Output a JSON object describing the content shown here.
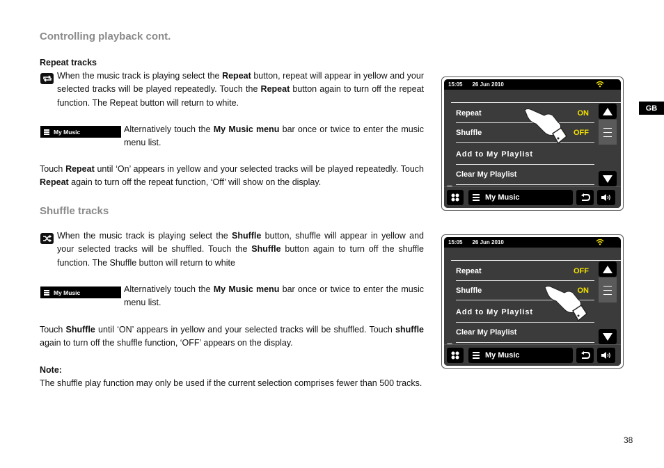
{
  "page": {
    "title": "Controlling playback cont.",
    "language_tab": "GB",
    "page_number": "38"
  },
  "repeat_section": {
    "heading": "Repeat tracks",
    "icon": "repeat-icon",
    "para1": [
      {
        "t": "When the music track is playing select the "
      },
      {
        "b": "Repeat"
      },
      {
        "t": " button, repeat will appear in yellow and your selected tracks will be played repeatedly. Touch the "
      },
      {
        "b": "Repeat"
      },
      {
        "t": " button again to turn off the repeat function. The Repeat button will return to white."
      }
    ],
    "menu_bar_label": "My Music",
    "para2": [
      {
        "t": "Alternatively touch the "
      },
      {
        "b": "My Music menu"
      },
      {
        "t": " bar once or twice to enter the music menu list."
      }
    ],
    "para3": [
      {
        "t": "Touch "
      },
      {
        "b": "Repeat"
      },
      {
        "t": " until ‘On’ appears in yellow and your selected tracks will be played repeatedly. Touch "
      },
      {
        "b": "Repeat"
      },
      {
        "t": " again to turn off the repeat function, ‘Off’ will show on the display."
      }
    ]
  },
  "shuffle_section": {
    "heading": "Shuffle tracks",
    "icon": "shuffle-icon",
    "para1": [
      {
        "t": "When the music track is playing select the "
      },
      {
        "b": "Shuffle"
      },
      {
        "t": " button, shuffle will appear in yellow and your selected tracks will be shuffled. Touch the "
      },
      {
        "b": "Shuffle"
      },
      {
        "t": " button again to turn off the shuffle function. The Shuffle button will return to white"
      }
    ],
    "menu_bar_label": "My Music",
    "para2": [
      {
        "t": "Alternatively touch the "
      },
      {
        "b": "My Music menu"
      },
      {
        "t": " bar once or twice to enter the music menu list."
      }
    ],
    "para3": [
      {
        "t": "Touch "
      },
      {
        "b": "Shuffle"
      },
      {
        "t": " until ‘ON’ appears in yellow and your selected tracks will be shuffled. Touch "
      },
      {
        "b": "shuffle"
      },
      {
        "t": " again to turn off the shuffle function, ‘OFF’ appears on the display."
      }
    ]
  },
  "note": {
    "heading": "Note:",
    "text": "The shuffle play function may only be used if the current selection comprises fewer than 500 tracks."
  },
  "screens": [
    {
      "time": "15:05",
      "date": "26 Jun 2010",
      "items": [
        {
          "label": "Repeat",
          "value": "ON"
        },
        {
          "label": "Shuffle",
          "value": "OFF"
        },
        {
          "label": "Add to My Playlist",
          "value": ""
        },
        {
          "label": "Clear My Playlist",
          "value": ""
        }
      ],
      "menu_label": "My Music",
      "pointer_target": "Repeat"
    },
    {
      "time": "15:05",
      "date": "26 Jun 2010",
      "items": [
        {
          "label": "Repeat",
          "value": "OFF"
        },
        {
          "label": "Shuffle",
          "value": "ON"
        },
        {
          "label": "Add to My Playlist",
          "value": ""
        },
        {
          "label": "Clear My Playlist",
          "value": ""
        }
      ],
      "menu_label": "My Music",
      "pointer_target": "Shuffle"
    }
  ],
  "colors": {
    "accent_yellow": "#f4e200",
    "heading_gray": "#8a8a8a",
    "screen_bg": "#3b3b3b"
  }
}
